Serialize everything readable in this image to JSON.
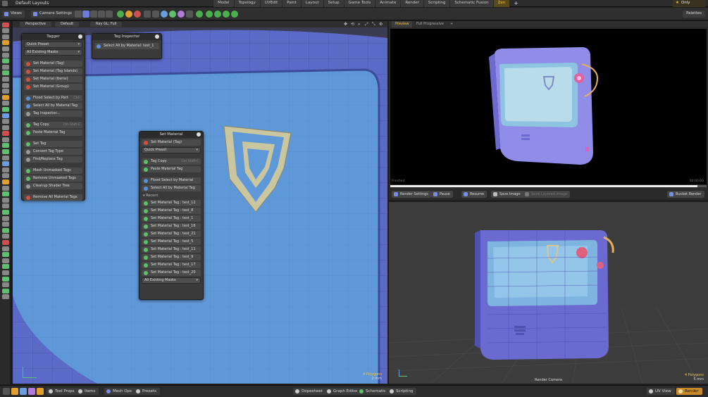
{
  "topbar": {
    "layout_name": "Default Layouts",
    "tabs": [
      "Model",
      "Topology",
      "UVEdit",
      "Paint",
      "Layout",
      "Setup",
      "Game Tools",
      "Animate",
      "Render",
      "Scripting",
      "Schematic Fusion",
      "Zen"
    ],
    "active_tab": "Zen",
    "add_tab": "+",
    "only_label": "Only"
  },
  "toolbar": {
    "views_label": "Views",
    "camera_settings_label": "Camera Settings",
    "palettes_label": "Palettes"
  },
  "viewport": {
    "tabs": [
      "Perspective",
      "Default",
      "Ray GL: Full"
    ],
    "polygons": "4 Polygons",
    "scale": "2 mm"
  },
  "tagger": {
    "title": "Tagger",
    "preset_select": "Quick Preset",
    "mask_select": "All Existing Masks",
    "buttons": [
      {
        "label": "Set Material (Tag)",
        "shortcut": ""
      },
      {
        "label": "Set Material (Tag Islands)",
        "shortcut": ""
      },
      {
        "label": "Set Material (Items)",
        "shortcut": ""
      },
      {
        "label": "Set Material (Group)",
        "shortcut": ""
      },
      {
        "label": "Flood Select by Part",
        "shortcut": "Ctrl-"
      },
      {
        "label": "Select All by Material Tag",
        "shortcut": ""
      },
      {
        "label": "Tag Inspector...",
        "shortcut": ""
      },
      {
        "label": "Tag Copy",
        "shortcut": "Ctrl-Shift-C"
      },
      {
        "label": "Paste Material Tag",
        "shortcut": ""
      },
      {
        "label": "Set Tag",
        "shortcut": ""
      },
      {
        "label": "Convert Tag Type",
        "shortcut": ""
      },
      {
        "label": "Find/Replace Tag",
        "shortcut": ""
      },
      {
        "label": "Mesh Unmasked Tags",
        "shortcut": ""
      },
      {
        "label": "Remove Unmasked Tags",
        "shortcut": ""
      },
      {
        "label": "Cleanup Shader Tree",
        "shortcut": ""
      },
      {
        "label": "Remove All Material Tags",
        "shortcut": ""
      }
    ]
  },
  "tag_inspector": {
    "title": "Tag Inspector",
    "button": "Select All by Material: test_1"
  },
  "set_material": {
    "title": "Set Material",
    "top_button": "Set Material (Tag)",
    "preset_select": "Quick Preset",
    "tag_copy": "Tag Copy",
    "tag_copy_shortcut": "Ctrl-Shift-C",
    "paste_tag": "Paste Material Tag",
    "flood_select": "Flood Select by Material",
    "select_all": "Select All by Material Tag",
    "recent_label": "Recent",
    "recent": [
      "Set Material Tag : test_12",
      "Set Material Tag : test_8",
      "Set Material Tag : test_1",
      "Set Material Tag : test_16",
      "Set Material Tag : test_21",
      "Set Material Tag : test_5",
      "Set Material Tag : test_11",
      "Set Material Tag : test_9",
      "Set Material Tag : test_17",
      "Set Material Tag : test_20"
    ],
    "mask_select": "All Existing Masks"
  },
  "preview": {
    "tabs": [
      "Preview",
      "Full Progressive"
    ],
    "add_tab": "+",
    "status": "Finished",
    "time": "00:00:00",
    "progress": 0.97,
    "buttons": [
      "Render Settings",
      "Pause",
      "Resume",
      "Save Image",
      "Save Layered Image",
      "Bucket Render"
    ]
  },
  "render_view": {
    "camera_label": "Render Camera",
    "polygons": "4 Polygons",
    "scale": "5 mm"
  },
  "bottombar": {
    "tool_props": "Tool Props",
    "items": "Items",
    "mesh_ops": "Mesh Ops",
    "presets": "Presets",
    "dopesheet": "Dopesheet",
    "graph_editor": "Graph Editor",
    "schematic": "Schematic",
    "scripting": "Scripting",
    "uv_view": "UV View",
    "render": "Render"
  },
  "colors": {
    "accent": "#f2c44a",
    "mesh_blue": "#6c7fd8",
    "mesh_light": "#8fb9e8",
    "render_btn": "#c98a2c"
  }
}
